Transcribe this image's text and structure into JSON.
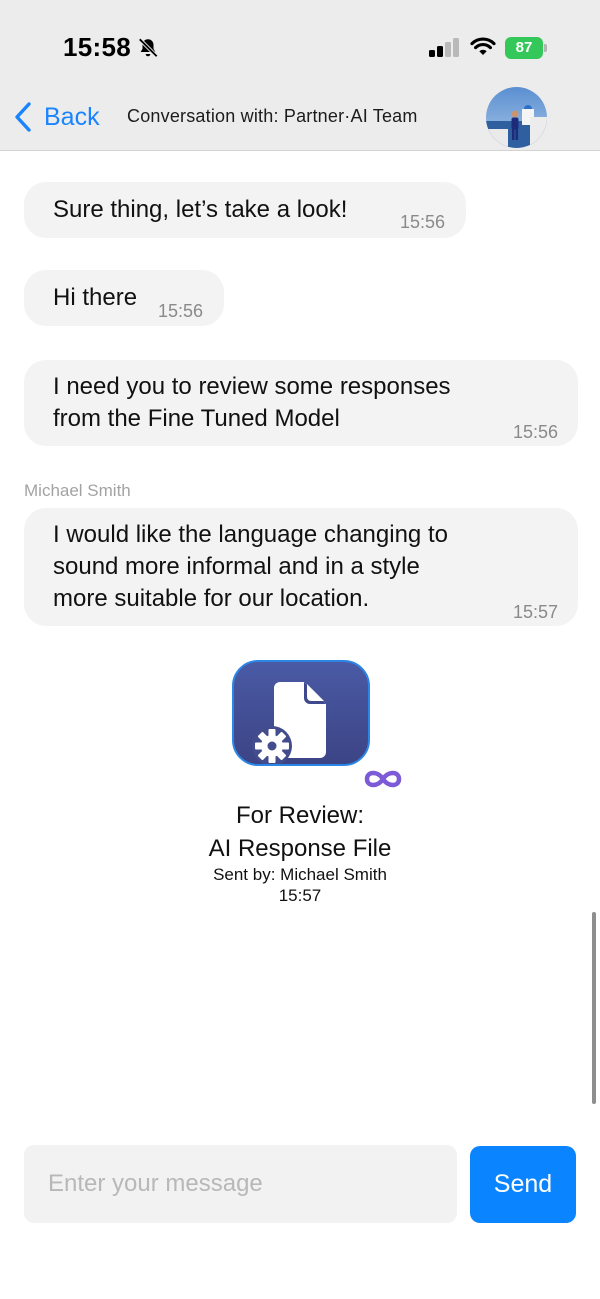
{
  "status_bar": {
    "time": "15:58",
    "battery_level": "87",
    "icons": [
      "bell-slash-icon",
      "cellular-signal-icon",
      "wifi-icon",
      "battery-charging-icon"
    ],
    "battery_color": "#34c759"
  },
  "nav": {
    "back_label": "Back",
    "title": "Conversation with: Partner·AI Team",
    "accent_color": "#1a84ff"
  },
  "messages": [
    {
      "text_lines": [
        "Sure thing, let’s take a look!"
      ],
      "time": "15:56"
    },
    {
      "text_lines": [
        "Hi there"
      ],
      "time": "15:56"
    },
    {
      "text_lines": [
        "I need you to review some responses",
        "from the Fine Tuned Model"
      ],
      "time": "15:56"
    },
    {
      "sender": "Michael Smith",
      "text_lines": [
        "I would like the language changing to",
        "sound more informal and in a style",
        "more suitable for our location."
      ],
      "time": "15:57"
    }
  ],
  "file_message": {
    "title_line1": "For Review:",
    "title_line2": "AI Response File",
    "sent_by": "Sent by: Michael Smith",
    "time": "15:57",
    "icon": "document-gear-icon"
  },
  "composer": {
    "placeholder": "Enter your message",
    "value": "",
    "send_label": "Send",
    "send_color": "#0a84ff"
  }
}
